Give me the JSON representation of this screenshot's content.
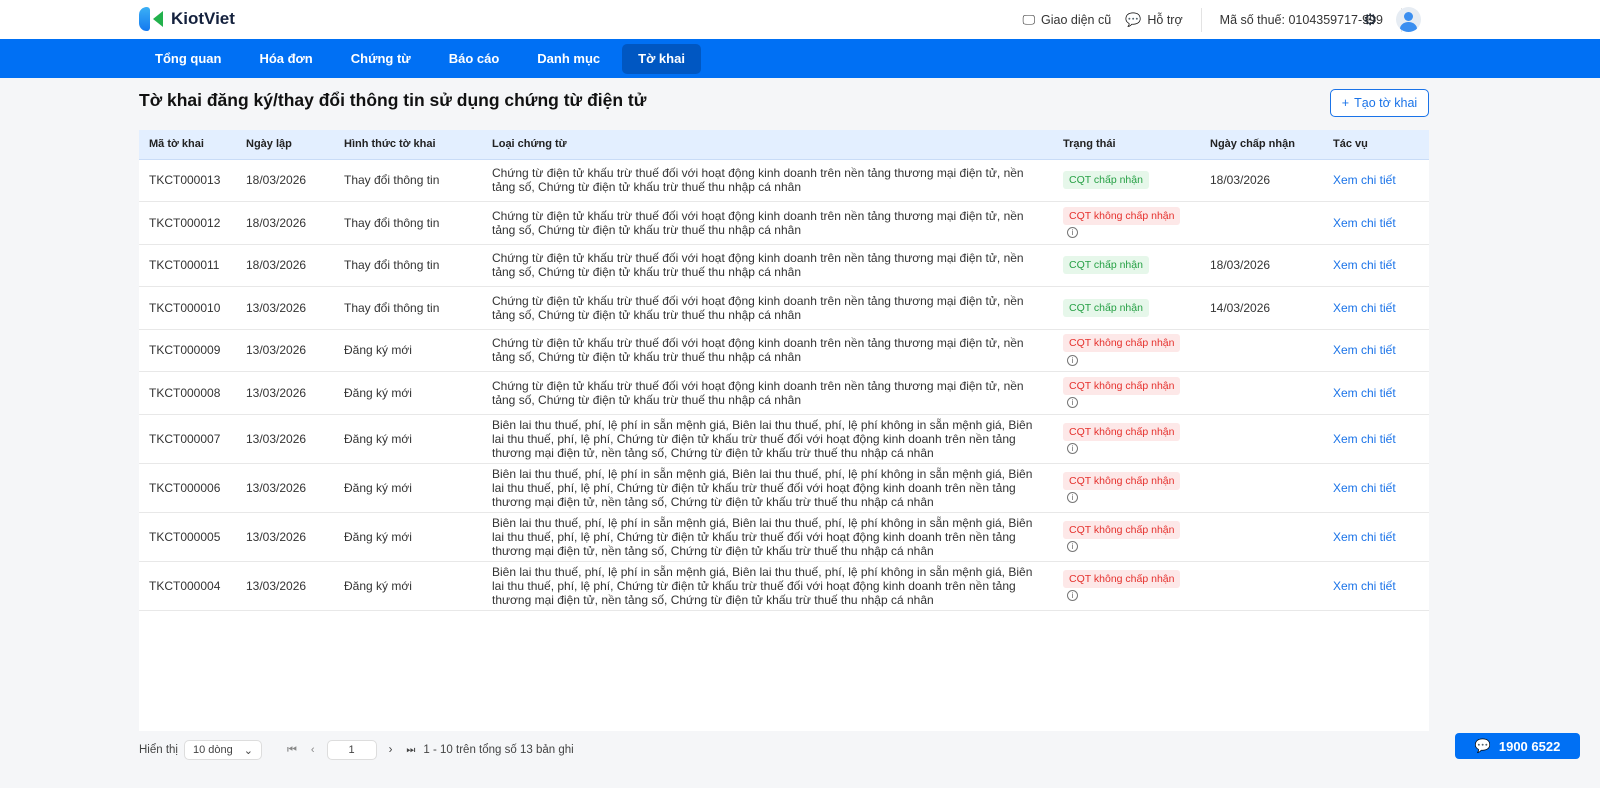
{
  "app": {
    "brand": "KiotViet"
  },
  "topbar": {
    "old_ui": "Giao diện cũ",
    "support": "Hỗ trợ",
    "tax_code": "Mã số thuế: 0104359717-999"
  },
  "nav": [
    {
      "label": "Tổng quan"
    },
    {
      "label": "Hóa đơn"
    },
    {
      "label": "Chứng từ"
    },
    {
      "label": "Báo cáo"
    },
    {
      "label": "Danh mục"
    },
    {
      "label": "Tờ khai",
      "active": true
    }
  ],
  "page": {
    "title": "Tờ khai đăng ký/thay đổi thông tin sử dụng chứng từ điện tử",
    "create_button": "Tạo tờ khai"
  },
  "table": {
    "headers": [
      "Mã tờ khai",
      "Ngày lập",
      "Hình thức tờ khai",
      "Loại chứng từ",
      "Trạng thái",
      "Ngày chấp nhận",
      "Tác vụ"
    ],
    "rows": [
      {
        "id": "TKCT000013",
        "date": "18/03/2026",
        "form": "Thay đổi thông tin",
        "type": "Chứng từ điện tử khấu trừ thuế đối với hoạt động kinh doanh trên nền tảng thương mại điện tử, nền tảng số, Chứng từ điện tử khấu trừ thuế thu nhập cá nhân",
        "status": "CQT chấp nhận",
        "ok": true,
        "accepted": "18/03/2026",
        "action": "Xem chi tiết"
      },
      {
        "id": "TKCT000012",
        "date": "18/03/2026",
        "form": "Thay đổi thông tin",
        "type": "Chứng từ điện tử khấu trừ thuế đối với hoạt động kinh doanh trên nền tảng thương mại điện tử, nền tảng số, Chứng từ điện tử khấu trừ thuế thu nhập cá nhân",
        "status": "CQT không chấp nhận",
        "ok": false,
        "accepted": "",
        "action": "Xem chi tiết"
      },
      {
        "id": "TKCT000011",
        "date": "18/03/2026",
        "form": "Thay đổi thông tin",
        "type": "Chứng từ điện tử khấu trừ thuế đối với hoạt động kinh doanh trên nền tảng thương mại điện tử, nền tảng số, Chứng từ điện tử khấu trừ thuế thu nhập cá nhân",
        "status": "CQT chấp nhận",
        "ok": true,
        "accepted": "18/03/2026",
        "action": "Xem chi tiết"
      },
      {
        "id": "TKCT000010",
        "date": "13/03/2026",
        "form": "Thay đổi thông tin",
        "type": "Chứng từ điện tử khấu trừ thuế đối với hoạt động kinh doanh trên nền tảng thương mại điện tử, nền tảng số, Chứng từ điện tử khấu trừ thuế thu nhập cá nhân",
        "status": "CQT chấp nhận",
        "ok": true,
        "accepted": "14/03/2026",
        "action": "Xem chi tiết"
      },
      {
        "id": "TKCT000009",
        "date": "13/03/2026",
        "form": "Đăng ký mới",
        "type": "Chứng từ điện tử khấu trừ thuế đối với hoạt động kinh doanh trên nền tảng thương mại điện tử, nền tảng số, Chứng từ điện tử khấu trừ thuế thu nhập cá nhân",
        "status": "CQT không chấp nhận",
        "ok": false,
        "accepted": "",
        "action": "Xem chi tiết"
      },
      {
        "id": "TKCT000008",
        "date": "13/03/2026",
        "form": "Đăng ký mới",
        "type": "Chứng từ điện tử khấu trừ thuế đối với hoạt động kinh doanh trên nền tảng thương mại điện tử, nền tảng số, Chứng từ điện tử khấu trừ thuế thu nhập cá nhân",
        "status": "CQT không chấp nhận",
        "ok": false,
        "accepted": "",
        "action": "Xem chi tiết"
      },
      {
        "id": "TKCT000007",
        "date": "13/03/2026",
        "form": "Đăng ký mới",
        "type": "Biên lai thu thuế, phí, lệ phí in sẵn mệnh giá, Biên lai thu thuế, phí, lệ phí không in sẵn mệnh giá, Biên lai thu thuế, phí, lệ phí, Chứng từ điện tử khấu trừ thuế đối với hoạt động kinh doanh trên nền tảng thương mại điện tử, nền tảng số, Chứng từ điện tử khấu trừ thuế thu nhập cá nhân",
        "status": "CQT không chấp nhận",
        "ok": false,
        "accepted": "",
        "action": "Xem chi tiết"
      },
      {
        "id": "TKCT000006",
        "date": "13/03/2026",
        "form": "Đăng ký mới",
        "type": "Biên lai thu thuế, phí, lệ phí in sẵn mệnh giá, Biên lai thu thuế, phí, lệ phí không in sẵn mệnh giá, Biên lai thu thuế, phí, lệ phí, Chứng từ điện tử khấu trừ thuế đối với hoạt động kinh doanh trên nền tảng thương mại điện tử, nền tảng số, Chứng từ điện tử khấu trừ thuế thu nhập cá nhân",
        "status": "CQT không chấp nhận",
        "ok": false,
        "accepted": "",
        "action": "Xem chi tiết"
      },
      {
        "id": "TKCT000005",
        "date": "13/03/2026",
        "form": "Đăng ký mới",
        "type": "Biên lai thu thuế, phí, lệ phí in sẵn mệnh giá, Biên lai thu thuế, phí, lệ phí không in sẵn mệnh giá, Biên lai thu thuế, phí, lệ phí, Chứng từ điện tử khấu trừ thuế đối với hoạt động kinh doanh trên nền tảng thương mại điện tử, nền tảng số, Chứng từ điện tử khấu trừ thuế thu nhập cá nhân",
        "status": "CQT không chấp nhận",
        "ok": false,
        "accepted": "",
        "action": "Xem chi tiết"
      },
      {
        "id": "TKCT000004",
        "date": "13/03/2026",
        "form": "Đăng ký mới",
        "type": "Biên lai thu thuế, phí, lệ phí in sẵn mệnh giá, Biên lai thu thuế, phí, lệ phí không in sẵn mệnh giá, Biên lai thu thuế, phí, lệ phí, Chứng từ điện tử khấu trừ thuế đối với hoạt động kinh doanh trên nền tảng thương mại điện tử, nền tảng số, Chứng từ điện tử khấu trừ thuế thu nhập cá nhân",
        "status": "CQT không chấp nhận",
        "ok": false,
        "accepted": "",
        "action": "Xem chi tiết"
      }
    ]
  },
  "pagination": {
    "show_label": "Hiển thị",
    "page_size": "10 dòng",
    "current_page": "1",
    "summary": "1 - 10 trên tổng số 13 bản ghi"
  },
  "hotline": "1900 6522"
}
